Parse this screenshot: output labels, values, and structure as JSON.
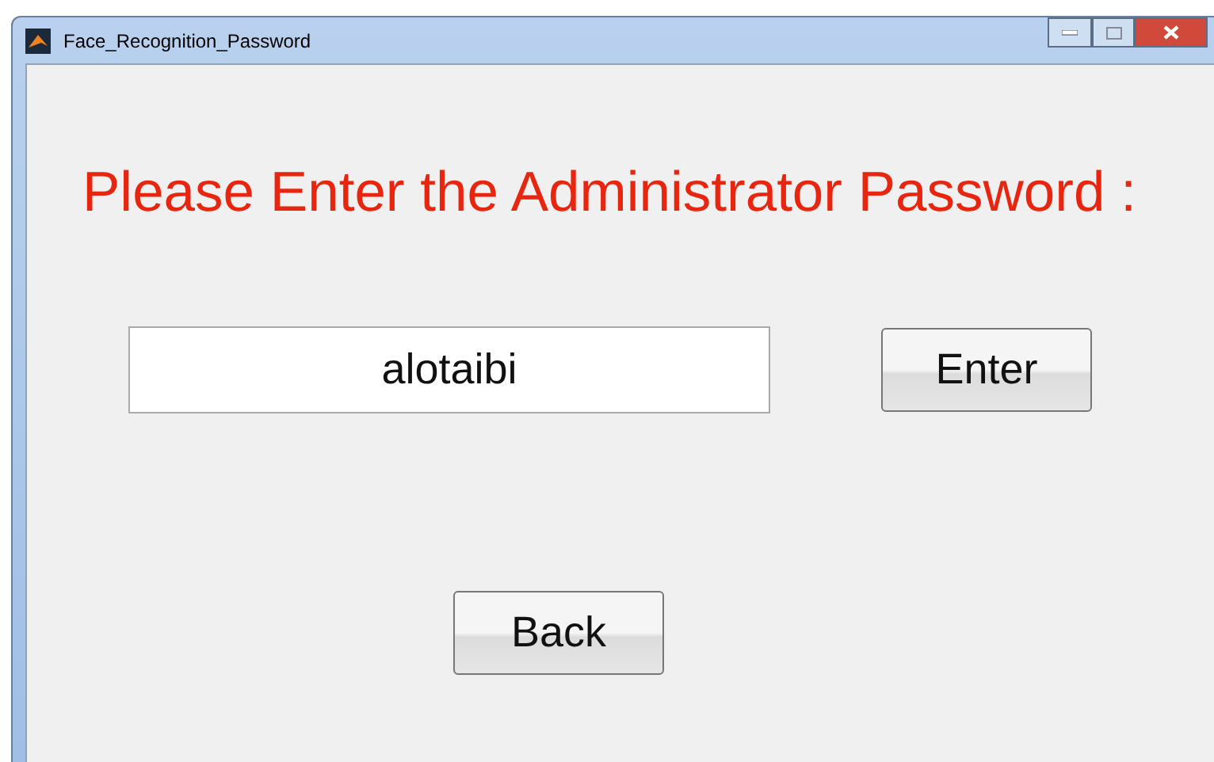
{
  "window": {
    "title": "Face_Recognition_Password"
  },
  "prompt": "Please Enter the Administrator Password :",
  "password_field": {
    "value": "alotaibi"
  },
  "buttons": [
    {
      "label": "Enter"
    },
    {
      "label": "Back"
    }
  ]
}
